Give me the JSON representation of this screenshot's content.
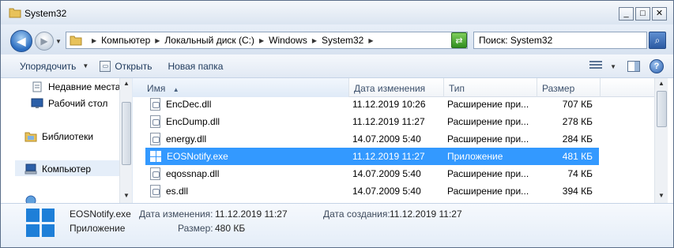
{
  "window": {
    "title": "System32",
    "min": "_",
    "max": "□",
    "close": "✕"
  },
  "address": {
    "crumbs": [
      "Компьютер",
      "Локальный диск (C:)",
      "Windows",
      "System32"
    ],
    "search_text": "Поиск: System32"
  },
  "toolbar": {
    "organize": "Упорядочить",
    "open": "Открыть",
    "new_folder": "Новая папка"
  },
  "nav": {
    "recent": "Недавние места",
    "desktop": "Рабочий стол",
    "libraries": "Библиотеки",
    "computer": "Компьютер"
  },
  "columns": {
    "name": "Имя",
    "date": "Дата изменения",
    "type": "Тип",
    "size": "Размер"
  },
  "files": [
    {
      "name": "EncDec.dll",
      "date": "11.12.2019 10:26",
      "type": "Расширение при...",
      "size": "707 КБ",
      "icon": "dll-icon"
    },
    {
      "name": "EncDump.dll",
      "date": "11.12.2019 11:27",
      "type": "Расширение при...",
      "size": "278 КБ",
      "icon": "dll-icon"
    },
    {
      "name": "energy.dll",
      "date": "14.07.2009 5:40",
      "type": "Расширение при...",
      "size": "284 КБ",
      "icon": "dll-icon"
    },
    {
      "name": "EOSNotify.exe",
      "date": "11.12.2019 11:27",
      "type": "Приложение",
      "size": "481 КБ",
      "icon": "windows-logo-icon",
      "selected": true
    },
    {
      "name": "eqossnap.dll",
      "date": "14.07.2009 5:40",
      "type": "Расширение при...",
      "size": "74 КБ",
      "icon": "dll-icon"
    },
    {
      "name": "es.dll",
      "date": "14.07.2009 5:40",
      "type": "Расширение при...",
      "size": "394 КБ",
      "icon": "dll-icon"
    }
  ],
  "details": {
    "name": "EOSNotify.exe",
    "kind": "Приложение",
    "modified_label": "Дата изменения:",
    "modified_value": "11.12.2019 11:27",
    "created_label": "Дата создания:",
    "created_value": "11.12.2019 11:27",
    "size_label": "Размер:",
    "size_value": "480 КБ"
  },
  "colors": {
    "selection": "#3399ff",
    "windows_blue": "#1e7fd8"
  }
}
